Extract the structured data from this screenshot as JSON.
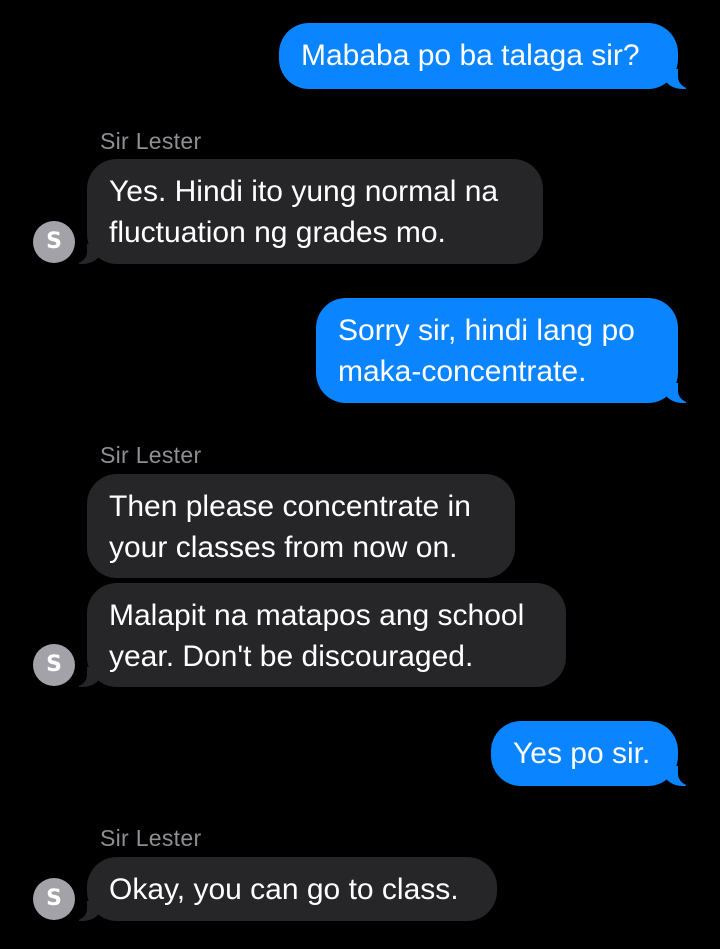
{
  "contact": {
    "name": "Sir Lester",
    "avatar_initial": "S"
  },
  "colors": {
    "background": "#000000",
    "outgoing_bubble": "#0a84ff",
    "incoming_bubble": "#262629",
    "sender_label": "#8e8e93",
    "avatar": "#a2a2a8"
  },
  "messages": [
    {
      "direction": "outgoing",
      "lines": [
        "Mababa po ba talaga sir?"
      ]
    },
    {
      "direction": "incoming",
      "sender": "Sir Lester",
      "lines": [
        "Yes. Hindi ito yung normal na",
        "fluctuation ng grades mo."
      ]
    },
    {
      "direction": "outgoing",
      "lines": [
        "Sorry sir, hindi lang po",
        "maka-concentrate."
      ]
    },
    {
      "direction": "incoming",
      "sender": "Sir Lester",
      "lines": [
        "Then please concentrate in",
        "your classes from now on."
      ]
    },
    {
      "direction": "incoming",
      "lines": [
        "Malapit na matapos ang school",
        "year. Don't be discouraged."
      ]
    },
    {
      "direction": "outgoing",
      "lines": [
        "Yes po sir."
      ]
    },
    {
      "direction": "incoming",
      "sender": "Sir Lester",
      "lines": [
        "Okay, you can go to class."
      ]
    }
  ]
}
